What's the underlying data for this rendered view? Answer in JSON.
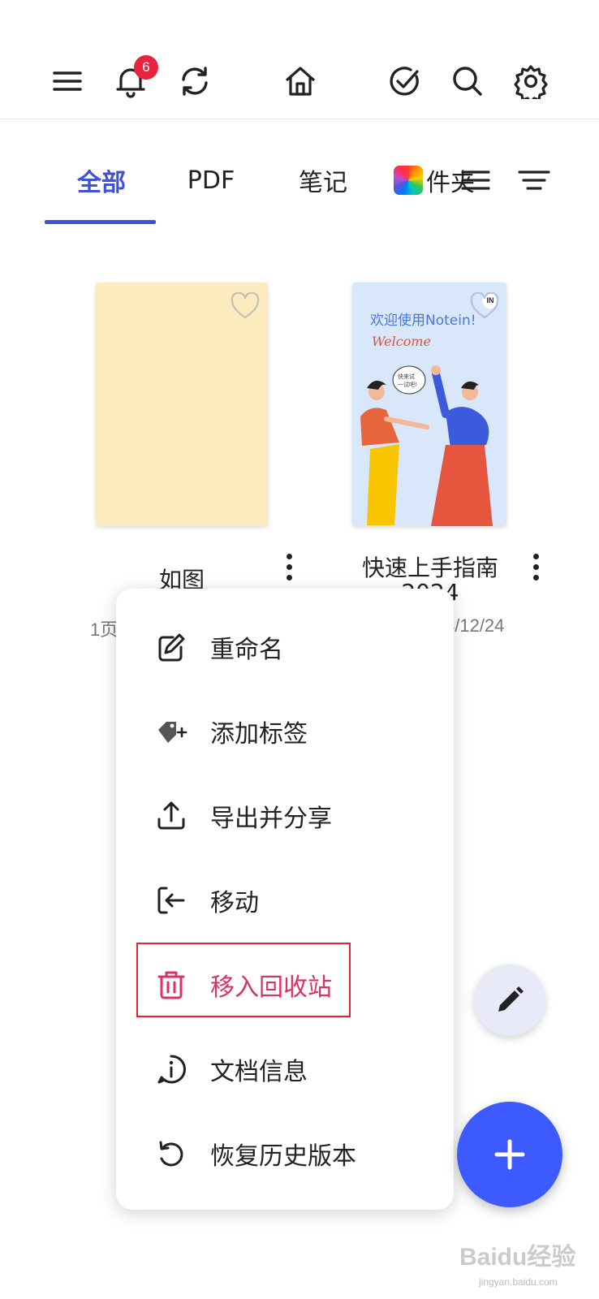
{
  "toolbar": {
    "notification_count": "6",
    "icons": [
      "menu-icon",
      "bell-icon",
      "sync-icon",
      "home-icon",
      "check-circle-icon",
      "search-icon",
      "gear-icon"
    ]
  },
  "tabs": [
    {
      "label": "全部",
      "active": true
    },
    {
      "label": "PDF"
    },
    {
      "label": "笔记"
    },
    {
      "label": "件夹"
    }
  ],
  "documents": [
    {
      "title": "如图",
      "meta": "1页"
    },
    {
      "title": "快速上手指南",
      "title_line2": "2024",
      "meta": "4/12/24",
      "cover": {
        "text_line1": "欢迎使用Notein!",
        "text_line2": "Welcome",
        "bubble_line1": "快来试",
        "bubble_line2": "一试吧!",
        "logo": "IN"
      }
    }
  ],
  "context_menu": {
    "items": [
      {
        "label": "重命名",
        "icon": "edit-icon"
      },
      {
        "label": "添加标签",
        "icon": "tag-add-icon"
      },
      {
        "label": "导出并分享",
        "icon": "upload-icon"
      },
      {
        "label": "移动",
        "icon": "move-icon"
      },
      {
        "label": "移入回收站",
        "icon": "trash-icon"
      },
      {
        "label": "文档信息",
        "icon": "info-icon"
      },
      {
        "label": "恢复历史版本",
        "icon": "history-icon"
      }
    ]
  },
  "watermark": {
    "text": "Baidu经验",
    "url": "jingyan.baidu.com"
  },
  "colors": {
    "accent": "#3f51d6",
    "danger": "#d93263",
    "fab": "#3d5afe",
    "badge": "#e8223f",
    "note_cover": "#fdebc0"
  }
}
